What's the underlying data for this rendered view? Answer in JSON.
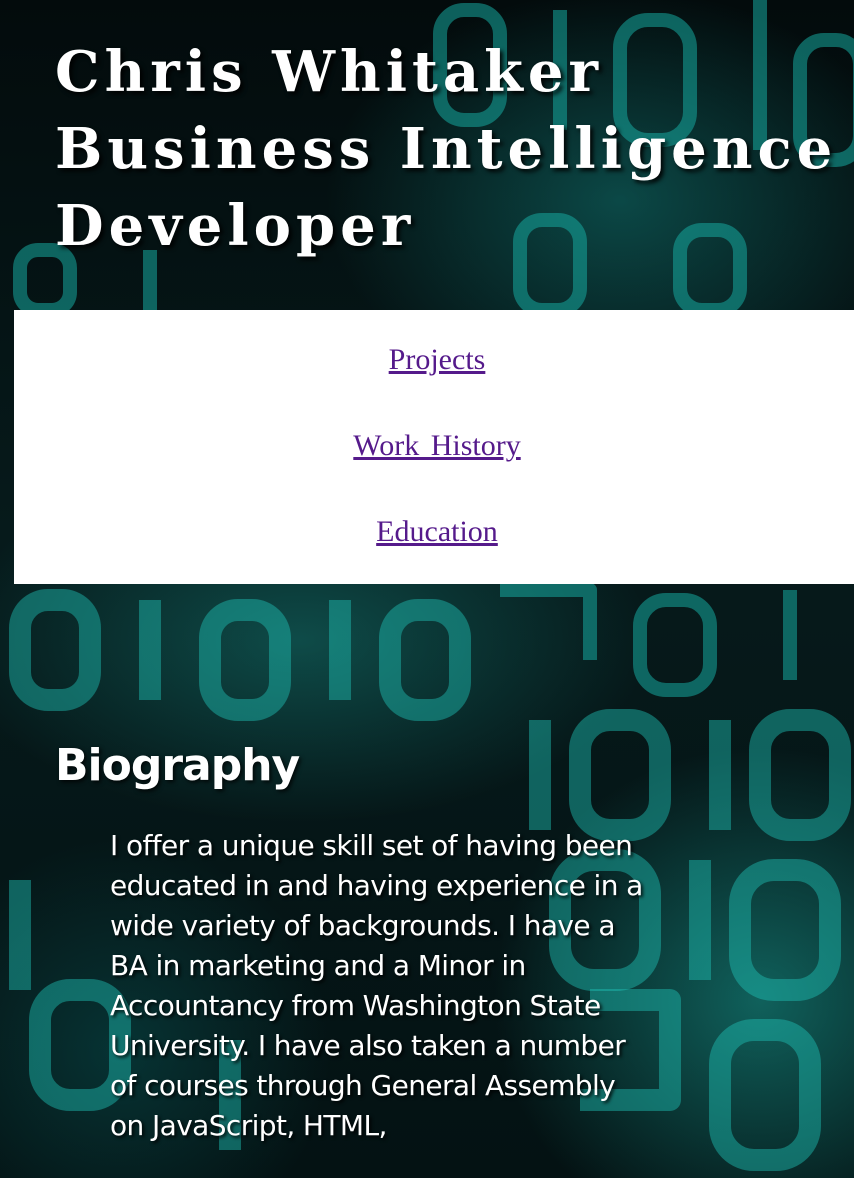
{
  "header": {
    "title_lines": [
      "Chris Whitaker",
      "Business Intelligence",
      "Developer"
    ]
  },
  "nav": {
    "items": [
      {
        "label": "Projects"
      },
      {
        "label": "Work History"
      },
      {
        "label": "Education"
      }
    ],
    "link_color": "#551a8b",
    "background_color": "#ffffff"
  },
  "bio": {
    "heading": "Biography",
    "text": "I offer a unique skill set of having been educated in and having experience in a wide variety of backgrounds. I have a BA in marketing and a Minor in Accountancy from Washington State University. I have also taken a number of courses through General Assembly on JavaScript, HTML,"
  },
  "background": {
    "description_icon": "binary-code-background",
    "accent_color": "#1aa9a0"
  }
}
